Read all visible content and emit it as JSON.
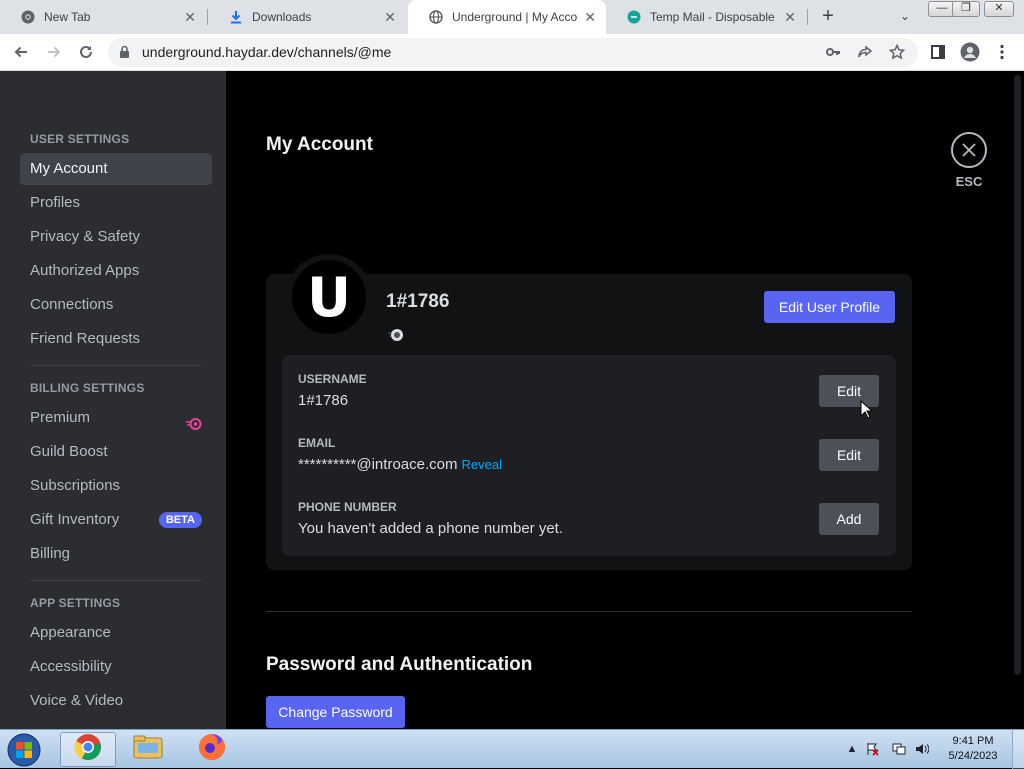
{
  "browser": {
    "tabs": [
      {
        "title": "New Tab",
        "icon": "chrome-icon"
      },
      {
        "title": "Downloads",
        "icon": "download-icon"
      },
      {
        "title": "Underground | My Account",
        "icon": "globe-icon",
        "active": true
      },
      {
        "title": "Temp Mail - Disposable Temporary Email",
        "icon": "tempmail-icon"
      }
    ],
    "url": "underground.haydar.dev/channels/@me"
  },
  "sidebar": {
    "user_settings_header": "USER SETTINGS",
    "user_items": [
      "My Account",
      "Profiles",
      "Privacy & Safety",
      "Authorized Apps",
      "Connections",
      "Friend Requests"
    ],
    "billing_header": "BILLING SETTINGS",
    "billing_items": [
      "Premium",
      "Guild Boost",
      "Subscriptions",
      "Gift Inventory",
      "Billing"
    ],
    "beta_badge": "BETA",
    "app_header": "APP SETTINGS",
    "app_items": [
      "Appearance",
      "Accessibility",
      "Voice & Video"
    ]
  },
  "main": {
    "title": "My Account",
    "esc_label": "ESC",
    "profile": {
      "avatar_letter": "U",
      "display_name": "1#1786",
      "edit_profile_label": "Edit User Profile"
    },
    "fields": {
      "username_label": "USERNAME",
      "username_value": "1#1786",
      "email_label": "EMAIL",
      "email_value": "**********@introace.com",
      "reveal_label": "Reveal",
      "phone_label": "PHONE NUMBER",
      "phone_value": "You haven't added a phone number yet.",
      "edit_label": "Edit",
      "add_label": "Add"
    },
    "password_title": "Password and Authentication",
    "change_password_label": "Change Password"
  },
  "taskbar": {
    "time": "9:41 PM",
    "date": "5/24/2023"
  },
  "colors": {
    "accent": "#5865f2",
    "sidebar_bg": "#2b2d31",
    "main_bg": "#000000",
    "card_bg": "#111214",
    "panel_bg": "#1e1f22",
    "link": "#00a8fc",
    "premium_pink": "#eb459e"
  }
}
